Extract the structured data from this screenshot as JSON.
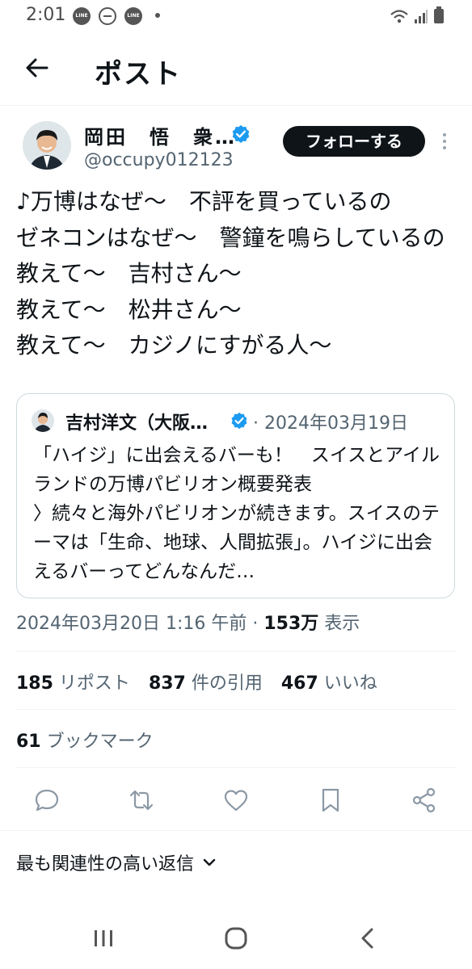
{
  "status_bar": {
    "time": "2:01",
    "notif_line_label": "LINE"
  },
  "header": {
    "title": "ポスト"
  },
  "post": {
    "author_name": "岡田　悟　衆…",
    "author_handle": "@occupy012123",
    "follow_label": "フォローする",
    "text": "♪万博はなぜ〜　不評を買っているの\nゼネコンはなぜ〜　警鐘を鳴らしているの\n教えて〜　吉村さん〜\n教えて〜　松井さん〜\n教えて〜　カジノにすがる人〜",
    "quote": {
      "author_name": "吉村洋文（大阪…",
      "date": "· 2024年03月19日",
      "text": "「ハイジ」に出会えるバーも！　スイスとアイルランドの万博パビリオン概要発表\n〉続々と海外パビリオンが続きます。スイスのテーマは「生命、地球、人間拡張」。ハイジに出会えるバーってどんなんだ…"
    },
    "timestamp": "2024年03月20日 1:16 午前 · ",
    "views_count": "153万",
    "views_label": " 表示",
    "stats": {
      "reposts_count": "185",
      "reposts_label": " リポスト",
      "quotes_count": "837",
      "quotes_label": " 件の引用",
      "likes_count": "467",
      "likes_label": " いいね",
      "bookmarks_count": "61",
      "bookmarks_label": " ブックマーク"
    }
  },
  "replies": {
    "sort_label": "最も関連性の高い返信"
  },
  "icons": {
    "back": "arrow-left-icon",
    "verified": "verified-badge-icon",
    "more": "more-vertical-icon",
    "reply": "comment-icon",
    "repost": "repost-icon",
    "like": "heart-icon",
    "bookmark": "bookmark-icon",
    "share": "share-icon",
    "chevron": "chevron-down-icon"
  },
  "colors": {
    "verified": "#1d9bf0",
    "follow_button": "#0f1419",
    "secondary_text": "#536471"
  }
}
